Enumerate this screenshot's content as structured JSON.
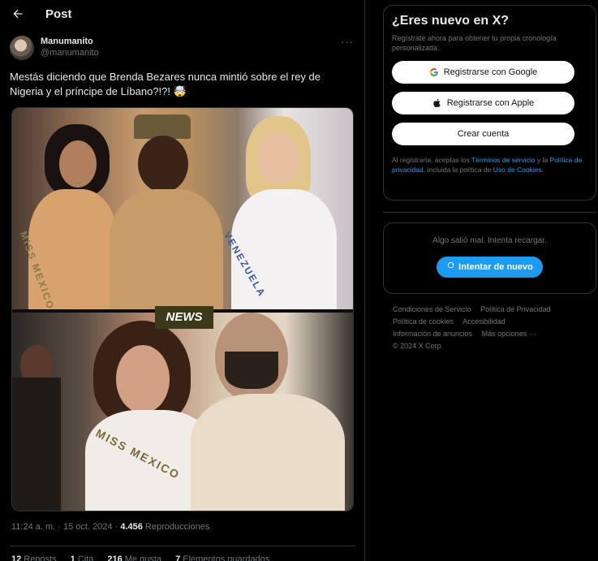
{
  "header": {
    "title": "Post"
  },
  "tweet": {
    "display_name": "Manumanito",
    "handle": "@manumanito",
    "text": "Mestás diciendo que Brenda Bezares nunca mintió sobre el rey de Nigeria y el príncipe de Líbano?!?! 🤯",
    "media_watermark": "NEWS",
    "sash_top_left": "MISS MEXICO",
    "sash_top_right": "VENEZUELA",
    "sash_bottom": "MISS MEXICO",
    "time": "11:24 a. m. · 15 oct. 2024 ·",
    "views_count": "4.456",
    "views_label": "Reproducciones",
    "stats": [
      {
        "count": "12",
        "label": "Reposts"
      },
      {
        "count": "1",
        "label": "Cita"
      },
      {
        "count": "216",
        "label": "Me gusta"
      },
      {
        "count": "7",
        "label": "Elementos guardados"
      }
    ]
  },
  "signup": {
    "title": "¿Eres nuevo en X?",
    "subtitle": "Regístrate ahora para obtener tu propia cronología personalizada.",
    "google_label": "Registrarse con Google",
    "apple_label": "Registrarse con Apple",
    "create_label": "Crear cuenta",
    "legal_prefix": "Al registrarte, aceptas los ",
    "terms_link": "Términos de servicio",
    "legal_mid": " y la ",
    "privacy_link": "Política de privacidad",
    "legal_mid2": ", incluida la política de ",
    "cookies_link": "Uso de Cookies",
    "legal_suffix": "."
  },
  "error_card": {
    "message": "Algo salió mal. Intenta recargar.",
    "retry_label": "Intentar de nuevo"
  },
  "footer": {
    "links": [
      "Condiciones de Servicio",
      "Política de Privacidad",
      "Política de cookies",
      "Accesibilidad",
      "Información de anuncios",
      "Más opciones ···"
    ],
    "copyright": "© 2024 X Corp."
  },
  "colors": {
    "accent": "#1d9bf0",
    "muted": "#71767b",
    "text": "#e7e9ea",
    "border": "#2f3336"
  }
}
